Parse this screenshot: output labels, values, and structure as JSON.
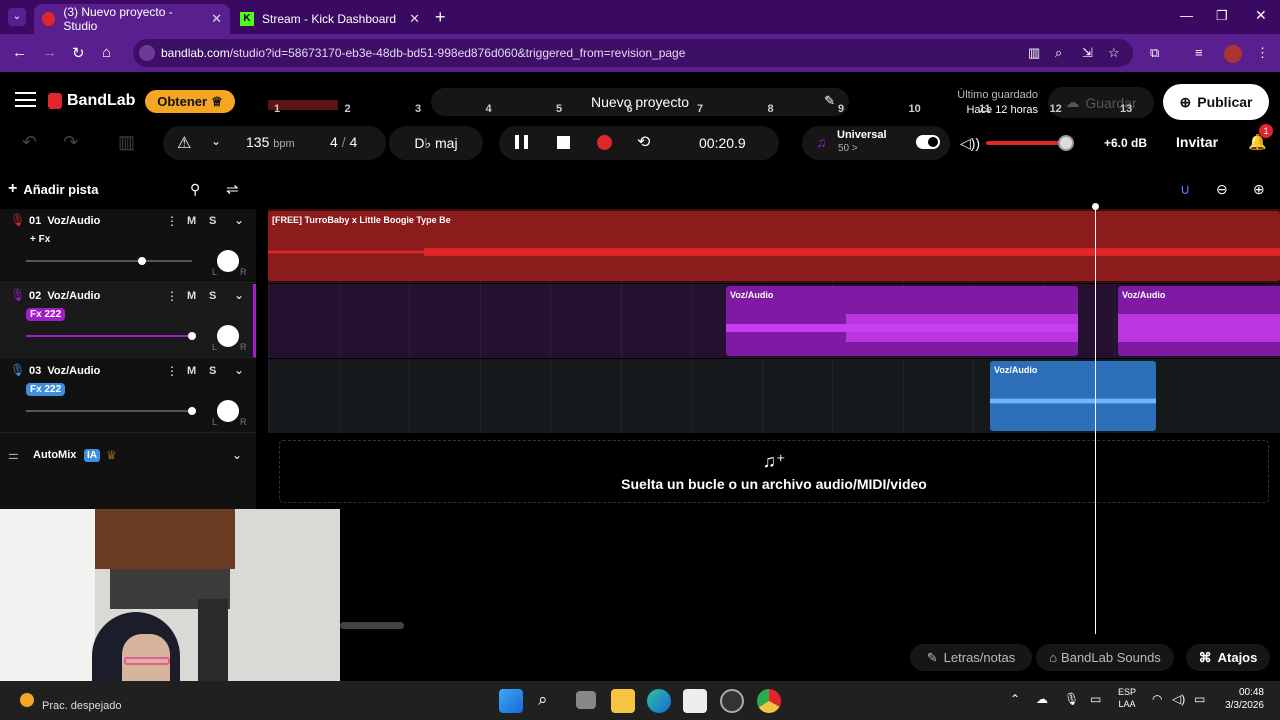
{
  "browser": {
    "tabs": [
      {
        "title": "(3) Nuevo proyecto - Studio",
        "active": true
      },
      {
        "title": "Stream - Kick Dashboard",
        "active": false
      }
    ],
    "url_host": "bandlab.com",
    "url_path": "/studio?id=58673170-eb3e-48db-bd51-998ed876d060&triggered_from=revision_page"
  },
  "header": {
    "logo": "BandLab",
    "obtener_label": "Obtener",
    "project_title": "Nuevo proyecto",
    "saved_label": "Último guardado",
    "saved_time": "Hace 12 horas",
    "guardar_label": "Guardar",
    "publicar_label": "Publicar"
  },
  "transport": {
    "bpm": "135",
    "bpm_unit": "bpm",
    "time_sig_num": "4",
    "time_sig_den": "4",
    "key": "D♭ maj",
    "time": "00:20.9",
    "preset_name": "Universal",
    "preset_value": "50 >",
    "volume_db": "+6.0 dB",
    "invitar_label": "Invitar",
    "notif_count": "1"
  },
  "sidebar": {
    "add_track_label": "Añadir pista",
    "tracks": [
      {
        "num": "01",
        "name": "Voz/Audio",
        "fx": "+ Fx",
        "fx_color": "#111",
        "mute": "M",
        "solo": "S",
        "pan_l": "L",
        "pan_r": "R",
        "color": "#e0262a",
        "volume": 0.7
      },
      {
        "num": "02",
        "name": "Voz/Audio",
        "fx": "Fx 222",
        "fx_color": "#a020c8",
        "mute": "M",
        "solo": "S",
        "pan_l": "L",
        "pan_r": "R",
        "color": "#a020c8",
        "volume": 1.0
      },
      {
        "num": "03",
        "name": "Voz/Audio",
        "fx": "Fx 222",
        "fx_color": "#3f8fe0",
        "mute": "M",
        "solo": "S",
        "pan_l": "L",
        "pan_r": "R",
        "color": "#3f8fe0",
        "volume": 1.0
      }
    ],
    "automix_label": "AutoMix",
    "automix_badge": "IA"
  },
  "ruler": [
    "1",
    "2",
    "3",
    "4",
    "5",
    "6",
    "7",
    "8",
    "9",
    "10",
    "11",
    "12",
    "13"
  ],
  "clips": {
    "track1": "[FREE] TurroBaby x Little Boogie Type Be",
    "track2a": "Voz/Audio",
    "track2b": "Voz/Audio",
    "track3": "Voz/Audio"
  },
  "dropzone": "Suelta un bucle o un archivo audio/MIDI/video",
  "footer": {
    "lyrics_label": "Letras/notas",
    "sounds_label": "BandLab Sounds",
    "shortcuts_label": "Atajos"
  },
  "taskbar": {
    "weather": "Prac. despejado",
    "lang1": "ESP",
    "lang2": "LAA",
    "clock": "00:48",
    "date": "3/3/2026"
  }
}
